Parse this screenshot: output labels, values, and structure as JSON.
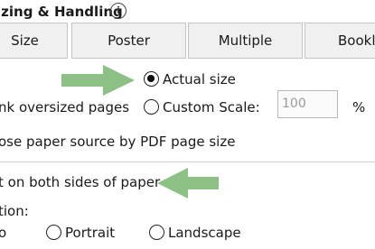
{
  "section": {
    "title": "izing & Handling",
    "info_glyph": "i"
  },
  "tabs": [
    {
      "label": "Size"
    },
    {
      "label": "Poster"
    },
    {
      "label": "Multiple"
    },
    {
      "label": "Bookle"
    }
  ],
  "sizing_options": {
    "actual_size_label": "Actual size",
    "actual_size_checked": true,
    "shrink_label": "nk oversized pages",
    "custom_scale_label": "Custom Scale:",
    "custom_scale_checked": false,
    "custom_scale_value": "100",
    "custom_scale_unit": "%",
    "paper_source_label": "ose paper source by PDF page size"
  },
  "duplex": {
    "label": "t on both sides of paper"
  },
  "orientation": {
    "label": "tion:",
    "auto_label": "o",
    "portrait_label": "Portrait",
    "landscape_label": "Landscape"
  },
  "annotations": {
    "arrow_color": "#8cc084"
  }
}
